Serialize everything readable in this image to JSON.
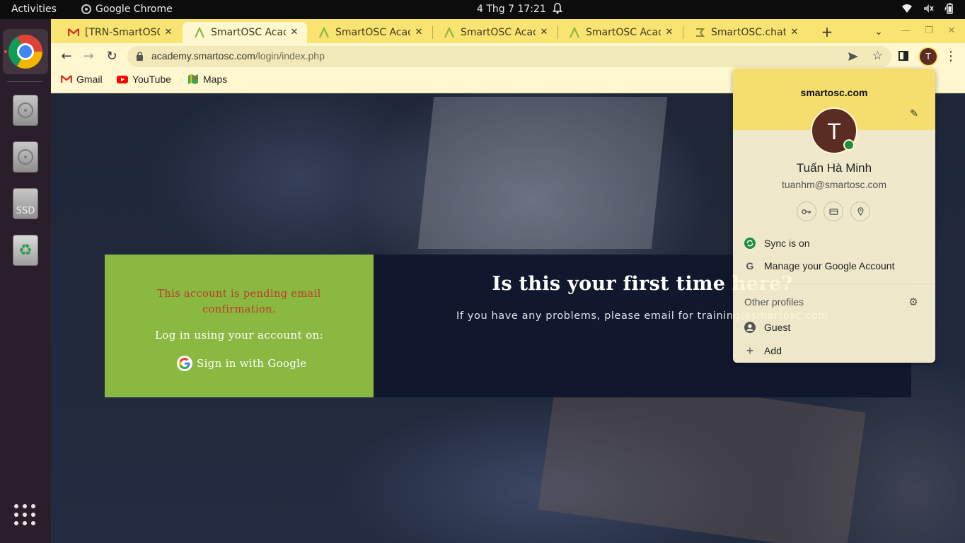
{
  "topbar": {
    "activities": "Activities",
    "app_name": "Google Chrome",
    "clock": "4 Thg 7  17:21"
  },
  "dock": {
    "items": [
      "chrome",
      "disk",
      "disk",
      "ssd",
      "trash"
    ],
    "ssd_label": "SSD",
    "running_color": "#e95420"
  },
  "tabs": [
    {
      "title": "[TRN-SmartOSC]",
      "favicon": "gmail-icon",
      "active": false
    },
    {
      "title": "SmartOSC Acade",
      "favicon": "academy-icon",
      "active": true
    },
    {
      "title": "SmartOSC Acade",
      "favicon": "academy-icon",
      "active": false
    },
    {
      "title": "SmartOSC Acade",
      "favicon": "academy-icon",
      "active": false
    },
    {
      "title": "SmartOSC Acade",
      "favicon": "academy-icon",
      "active": false
    },
    {
      "title": "SmartOSC.chat",
      "favicon": "chat-icon",
      "active": false
    }
  ],
  "toolbar": {
    "url_host": "academy.smartosc.com",
    "url_path": "/login/index.php",
    "profile_initial": "T"
  },
  "bookmarks": [
    {
      "label": "Gmail",
      "icon": "gmail-icon"
    },
    {
      "label": "YouTube",
      "icon": "youtube-icon"
    },
    {
      "label": "Maps",
      "icon": "maps-icon"
    }
  ],
  "login": {
    "error": "This account is pending email confirmation.",
    "login_using": "Log in using your account on:",
    "google_button": "Sign in with Google",
    "first_time_heading": "Is this your first time here?",
    "help_text": "If you have any problems, please email for training@smartosc.com"
  },
  "profile_popup": {
    "domain": "smartosc.com",
    "avatar_initial": "T",
    "name": "Tuấn Hà Minh",
    "email": "tuanhm@smartosc.com",
    "sync_status": "Sync is on",
    "manage_account": "Manage your Google Account",
    "other_profiles": "Other profiles",
    "guest": "Guest",
    "add": "Add"
  },
  "colors": {
    "tabstrip": "#f9e371",
    "toolbar": "#fff7cf",
    "login_green": "#8ab941",
    "login_navy": "#11182e",
    "error_red": "#c0392b",
    "avatar": "#5a2c22",
    "sync_green": "#1e8e3e"
  }
}
